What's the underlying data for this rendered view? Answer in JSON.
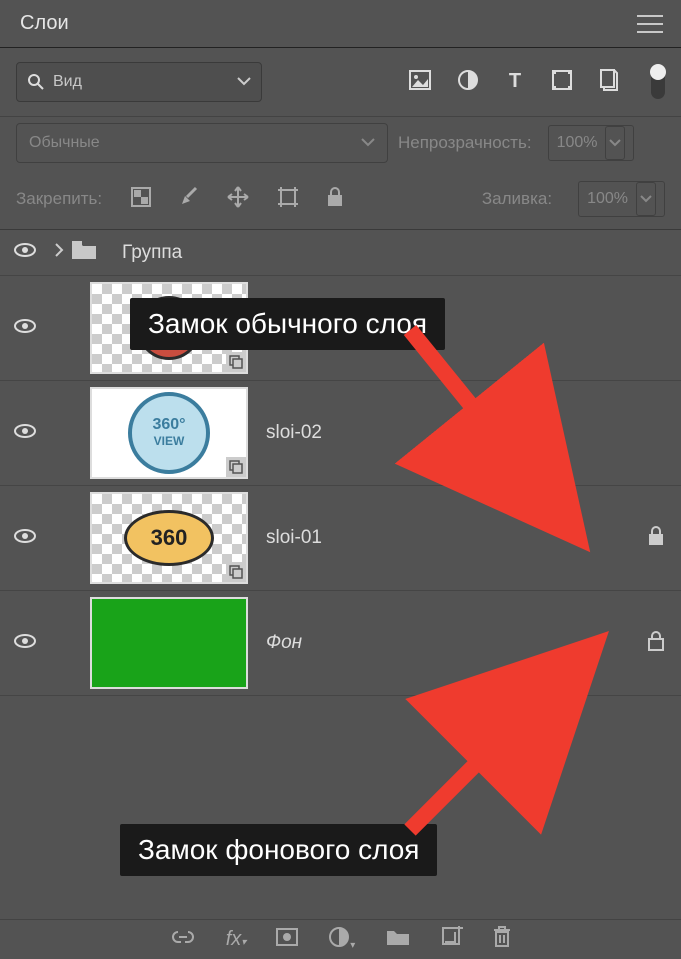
{
  "tab": {
    "title": "Слои"
  },
  "search": {
    "label": "Вид"
  },
  "blend": {
    "mode": "Обычные",
    "opacity_label": "Непрозрачность:",
    "opacity_value": "100%"
  },
  "lockbar": {
    "label": "Закрепить:",
    "fill_label": "Заливка:",
    "fill_value": "100%"
  },
  "layers": [
    {
      "name": "Группа",
      "type": "group"
    },
    {
      "name": "",
      "type": "smart",
      "thumb": "red"
    },
    {
      "name": "sloi-02",
      "type": "smart",
      "thumb": "blue"
    },
    {
      "name": "sloi-01",
      "type": "smart",
      "thumb": "orange",
      "locked": true
    },
    {
      "name": "Фон",
      "type": "background",
      "thumb": "green",
      "locked": true,
      "italic": true
    }
  ],
  "thumb_text": {
    "orange": "360",
    "blue_top": "360°",
    "blue_bottom": "VIEW"
  },
  "annotations": {
    "normal_lock": "Замок обычного слоя",
    "bg_lock": "Замок фонового слоя"
  }
}
